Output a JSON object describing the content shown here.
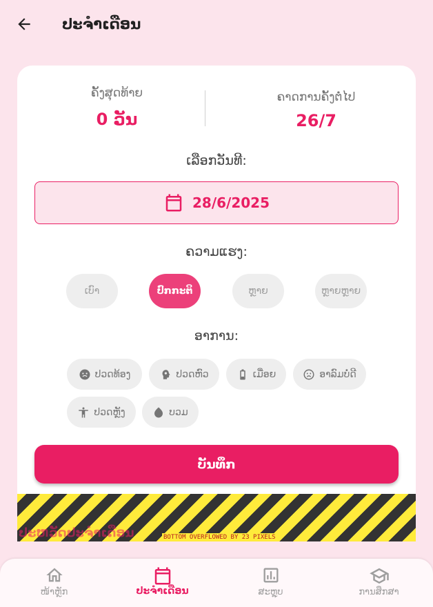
{
  "appbar": {
    "title": "ປະຈຳເດືອນ",
    "back_icon": "arrow-left-icon"
  },
  "stats": {
    "last": {
      "label": "ຄັ້ງສຸດທ້າຍ",
      "value": "0 ວັນ"
    },
    "next": {
      "label": "ຄາດການຄັ້ງຕໍ່ໄປ",
      "value": "26/7"
    }
  },
  "date": {
    "label": "ເລືອກວັນທີ:",
    "value": "28/6/2025",
    "icon": "calendar-icon"
  },
  "severity": {
    "label": "ຄວາມແຮງ:",
    "options": [
      "ເບົາ",
      "ປົກກະຕິ",
      "ຫຼາຍ",
      "ຫຼາຍຫຼາຍ"
    ],
    "selected": "ປົກກະຕິ"
  },
  "symptoms": {
    "label": "ອາການ:",
    "items": [
      {
        "label": "ປວດທ້ອງ",
        "icon": "stomach-icon"
      },
      {
        "label": "ປວດຫົວ",
        "icon": "head-icon"
      },
      {
        "label": "ເມື່ອຍ",
        "icon": "battery-low-icon"
      },
      {
        "label": "ອາລົມບໍ່ດີ",
        "icon": "sad-face-icon"
      },
      {
        "label": "ປວດຫຼັງ",
        "icon": "person-back-icon"
      },
      {
        "label": "ບວມ",
        "icon": "drop-icon"
      }
    ]
  },
  "save_button": {
    "label": "ບັນທຶກ"
  },
  "overflow": {
    "ghost_text": "ປະຫວັດປະຈຳເດືອນ",
    "message": "BOTTOM OVERFLOWED BY 23 PIXELS"
  },
  "bottom_nav": {
    "items": [
      {
        "label": "ໜ້າຫຼັກ",
        "icon": "home-icon"
      },
      {
        "label": "ປະຈຳເດືອນ",
        "icon": "calendar-icon"
      },
      {
        "label": "ສະຫຼຸບ",
        "icon": "bar-chart-icon"
      },
      {
        "label": "ການສຶກສາ",
        "icon": "graduation-cap-icon"
      }
    ],
    "active_index": 1
  },
  "colors": {
    "accent": "#e91e63",
    "background": "#fce4ec",
    "chip": "#eeeeee"
  }
}
